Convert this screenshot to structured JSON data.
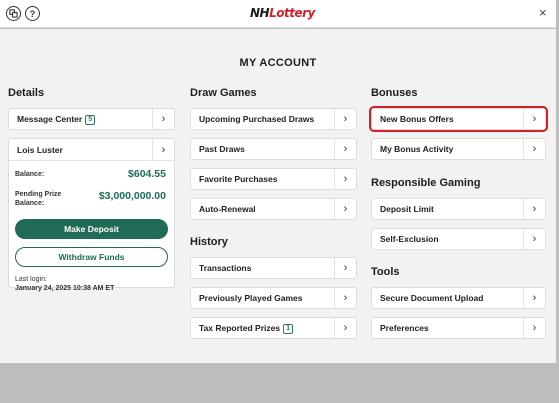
{
  "header": {
    "logo_prefix": "NH",
    "logo_suffix": "Lottery",
    "help_label": "?",
    "close_label": "×"
  },
  "page_title": "MY ACCOUNT",
  "details": {
    "heading": "Details",
    "message_center": {
      "label": "Message Center",
      "badge": "5"
    },
    "account_name": "Lois Luster",
    "balance_label": "Balance:",
    "balance_value": "$604.55",
    "pending_label_1": "Pending Prize",
    "pending_label_2": "Balance:",
    "pending_value": "$3,000,000.00",
    "deposit_label": "Make Deposit",
    "withdraw_label": "Withdraw Funds",
    "last_login_label": "Last login:",
    "last_login_value": "January 24, 2025 10:38 AM ET"
  },
  "draw_games": {
    "heading": "Draw Games",
    "items": [
      {
        "label": "Upcoming Purchased Draws"
      },
      {
        "label": "Past Draws"
      },
      {
        "label": "Favorite Purchases"
      },
      {
        "label": "Auto-Renewal"
      }
    ]
  },
  "history": {
    "heading": "History",
    "items": [
      {
        "label": "Transactions"
      },
      {
        "label": "Previously Played Games"
      },
      {
        "label": "Tax Reported Prizes",
        "badge": "1"
      }
    ]
  },
  "bonuses": {
    "heading": "Bonuses",
    "items": [
      {
        "label": "New Bonus Offers",
        "highlighted": true
      },
      {
        "label": "My Bonus Activity"
      }
    ]
  },
  "responsible_gaming": {
    "heading": "Responsible Gaming",
    "items": [
      {
        "label": "Deposit Limit"
      },
      {
        "label": "Self-Exclusion"
      }
    ]
  },
  "tools": {
    "heading": "Tools",
    "items": [
      {
        "label": "Secure Document Upload"
      },
      {
        "label": "Preferences"
      }
    ]
  },
  "chevron": "›",
  "colors": {
    "brand_green": "#1f6b55",
    "highlight_red": "#d41e28",
    "logo_red": "#d4202a"
  }
}
